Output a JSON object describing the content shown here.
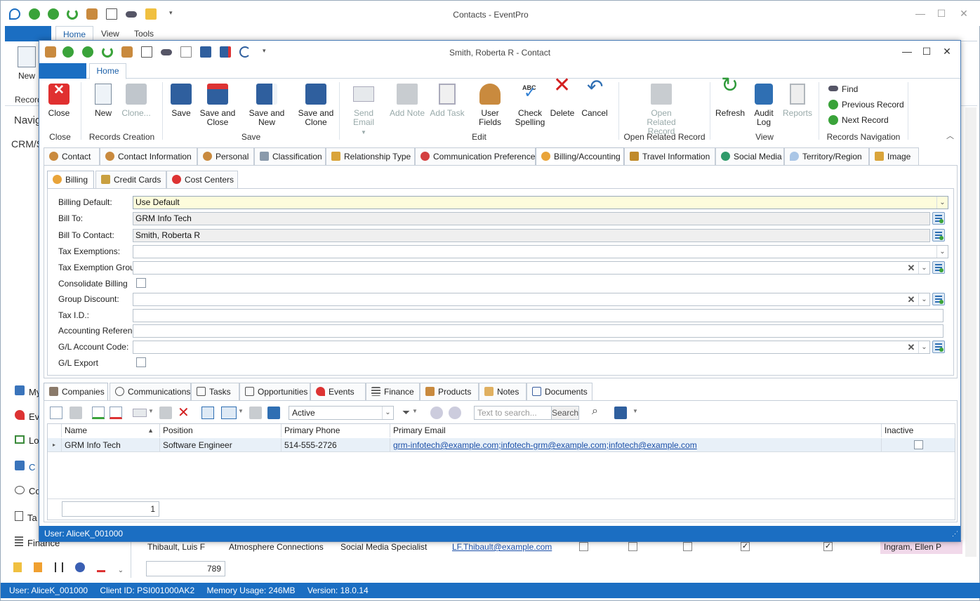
{
  "outer": {
    "title": "Contacts - EventPro",
    "tabs": [
      "Home",
      "View",
      "Tools"
    ],
    "ribbon_new": "New",
    "ribbon_group": "Record",
    "nav_title": "Navig",
    "nav_sub": "CRM/S",
    "nav_items": [
      "My",
      "Ev",
      "Lo",
      "C",
      "Co",
      "Ta",
      "Finance"
    ],
    "bg_row": {
      "name": "Thibault, Luis F",
      "company": "Atmosphere Connections",
      "title": "Social Media Specialist",
      "email": "LF.Thibault@example.com",
      "owner": "Ingram, Ellen P"
    },
    "bg_count": "789",
    "status": {
      "user": "User: AliceK_001000",
      "client": "Client ID: PSI001000AK2",
      "memory": "Memory Usage: 246MB",
      "version": "Version: 18.0.14"
    }
  },
  "win": {
    "title": "Smith, Roberta R - Contact",
    "tab_home": "Home",
    "status": "User: AliceK_001000"
  },
  "ribbon": {
    "close": "Close",
    "new": "New",
    "clone": "Clone...",
    "save": "Save",
    "save_close": [
      "Save and",
      "Close"
    ],
    "save_new": "Save and New",
    "save_clone": [
      "Save and",
      "Clone"
    ],
    "send_email": "Send Email",
    "add_note": "Add Note",
    "add_task": "Add Task",
    "user_fields": "User Fields",
    "check_spelling": [
      "Check",
      "Spelling"
    ],
    "delete": "Delete",
    "cancel": "Cancel",
    "open_related": [
      "Open Related",
      "Record"
    ],
    "refresh": "Refresh",
    "audit_log": [
      "Audit",
      "Log"
    ],
    "reports": "Reports",
    "find": "Find",
    "previous_record": "Previous Record",
    "next_record": "Next Record",
    "groups": [
      "Close",
      "Records Creation",
      "Save",
      "Edit",
      "Open Related Record",
      "View",
      "Records Navigation"
    ]
  },
  "main_tabs": [
    "Contact",
    "Contact Information",
    "Personal",
    "Classification",
    "Relationship Type",
    "Communication Preferences",
    "Billing/Accounting",
    "Travel Information",
    "Social Media",
    "Territory/Region",
    "Image"
  ],
  "sub_tabs": [
    "Billing",
    "Credit Cards",
    "Cost Centers"
  ],
  "form": {
    "billing_default": {
      "label": "Billing Default:",
      "value": "Use Default"
    },
    "bill_to": {
      "label": "Bill To:",
      "value": "GRM Info Tech"
    },
    "bill_to_contact": {
      "label": "Bill To Contact:",
      "value": "Smith, Roberta R"
    },
    "tax_exemptions": {
      "label": "Tax Exemptions:",
      "value": ""
    },
    "tax_exemption_group": {
      "label": "Tax Exemption Group:",
      "value": ""
    },
    "consolidate_billing": {
      "label": "Consolidate Billing",
      "checked": false
    },
    "group_discount": {
      "label": "Group Discount:",
      "value": ""
    },
    "tax_id": {
      "label": "Tax I.D.:",
      "value": ""
    },
    "accounting_reference": {
      "label": "Accounting Reference:",
      "value": ""
    },
    "gl_account_code": {
      "label": "G/L Account Code:",
      "value": ""
    },
    "gl_export": {
      "label": "G/L Export",
      "checked": false
    }
  },
  "bottom_tabs": [
    "Companies",
    "Communications",
    "Tasks",
    "Opportunities",
    "Events",
    "Finance",
    "Products",
    "Notes",
    "Documents"
  ],
  "grid_toolbar": {
    "filter_value": "Active",
    "search_placeholder": "Text to search...",
    "search_button": "Search"
  },
  "grid": {
    "columns": [
      "Name",
      "Position",
      "Primary Phone",
      "Primary Email",
      "Inactive"
    ],
    "rows": [
      {
        "name": "GRM Info Tech",
        "position": "Software Engineer",
        "phone": "514-555-2726",
        "email": "grm-infotech@example.com;infotech-grm@example.com;infotech@example.com",
        "inactive": false
      }
    ],
    "count": "1"
  },
  "colors": {
    "accent": "#1b6ec2",
    "highlight": "#fdfcdc"
  }
}
